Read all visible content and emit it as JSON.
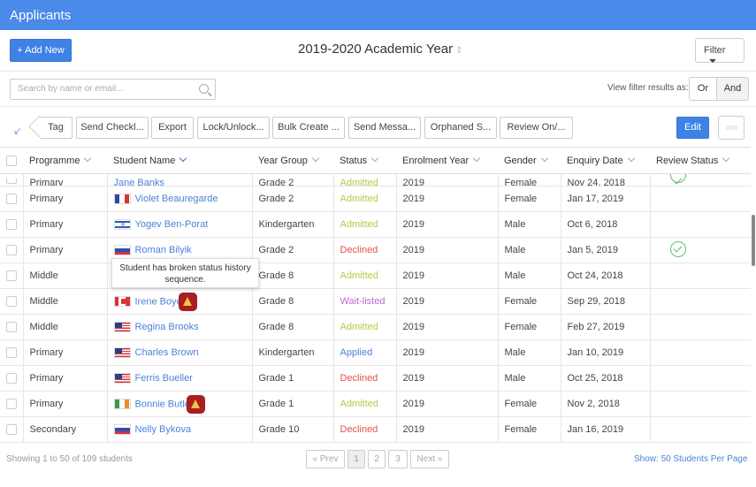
{
  "titlebar": {
    "title": "Applicants"
  },
  "topbar": {
    "add_new": "+ Add New",
    "academic_year": "2019-2020 Academic Year",
    "filter": "Filter"
  },
  "search": {
    "placeholder": "Search by name or email...",
    "view_filter_label": "View filter results as:",
    "or": "Or",
    "and": "And"
  },
  "toolbar": {
    "tag": "Tag",
    "send_checklist": "Send Checkl...",
    "export": "Export",
    "lock_unlock": "Lock/Unlock...",
    "bulk_create": "Bulk Create ...",
    "send_message": "Send Messa...",
    "orphaned": "Orphaned S...",
    "review_on": "Review On/...",
    "edit": "Edit"
  },
  "table": {
    "columns": [
      "Programme",
      "Student Name",
      "Year Group",
      "Status",
      "Enrolment Year",
      "Gender",
      "Enquiry Date",
      "Review Status"
    ],
    "partial_row": {
      "programme": "Primary",
      "name": "Jane Banks",
      "year_group": "Grade 2",
      "status": "Admitted",
      "enrolment": "2019",
      "gender": "Female",
      "date": "Nov 24, 2018"
    },
    "rows": [
      {
        "programme": "Primary",
        "name": "Violet Beauregarde",
        "flag": "fr",
        "year_group": "Grade 2",
        "status": "Admitted",
        "status_class": "admitted",
        "enrolment": "2019",
        "gender": "Female",
        "date": "Jan 17, 2019",
        "review": false,
        "warn": false
      },
      {
        "programme": "Primary",
        "name": "Yogev Ben-Porat",
        "flag": "il",
        "year_group": "Kindergarten",
        "status": "Admitted",
        "status_class": "admitted",
        "enrolment": "2019",
        "gender": "Male",
        "date": "Oct 6, 2018",
        "review": false,
        "warn": false
      },
      {
        "programme": "Primary",
        "name": "Roman Bilyik",
        "flag": "ru",
        "year_group": "Grade 2",
        "status": "Declined",
        "status_class": "declined",
        "enrolment": "2019",
        "gender": "Male",
        "date": "Jan 5, 2019",
        "review": true,
        "warn": false
      },
      {
        "programme": "Middle",
        "name": "",
        "flag": "",
        "year_group": "Grade 8",
        "status": "Admitted",
        "status_class": "admitted",
        "enrolment": "2019",
        "gender": "Male",
        "date": "Oct 24, 2018",
        "review": false,
        "warn": false
      },
      {
        "programme": "Middle",
        "name": "Irene Boye",
        "flag": "ca",
        "year_group": "Grade 8",
        "status": "Wait-listed",
        "status_class": "wait",
        "enrolment": "2019",
        "gender": "Female",
        "date": "Sep 29, 2018",
        "review": false,
        "warn": true
      },
      {
        "programme": "Middle",
        "name": "Regina Brooks",
        "flag": "us",
        "year_group": "Grade 8",
        "status": "Admitted",
        "status_class": "admitted",
        "enrolment": "2019",
        "gender": "Female",
        "date": "Feb 27, 2019",
        "review": false,
        "warn": false
      },
      {
        "programme": "Primary",
        "name": "Charles Brown",
        "flag": "us",
        "year_group": "Kindergarten",
        "status": "Applied",
        "status_class": "applied",
        "enrolment": "2019",
        "gender": "Male",
        "date": "Jan 10, 2019",
        "review": false,
        "warn": false
      },
      {
        "programme": "Primary",
        "name": "Ferris Bueller",
        "flag": "us",
        "year_group": "Grade 1",
        "status": "Declined",
        "status_class": "declined",
        "enrolment": "2019",
        "gender": "Male",
        "date": "Oct 25, 2018",
        "review": false,
        "warn": false
      },
      {
        "programme": "Primary",
        "name": "Bonnie Butle",
        "flag": "ie",
        "year_group": "Grade 1",
        "status": "Admitted",
        "status_class": "admitted",
        "enrolment": "2019",
        "gender": "Female",
        "date": "Nov 2, 2018",
        "review": false,
        "warn": true
      },
      {
        "programme": "Secondary",
        "name": "Nelly Bykova",
        "flag": "ru",
        "year_group": "Grade 10",
        "status": "Declined",
        "status_class": "declined",
        "enrolment": "2019",
        "gender": "Female",
        "date": "Jan 16, 2019",
        "review": false,
        "warn": false
      }
    ]
  },
  "tooltip": {
    "text": "Student has broken status history sequence."
  },
  "footer": {
    "showing": "Showing 1 to 50 of 109 students",
    "prev": "« Prev",
    "pages": [
      "1",
      "2",
      "3"
    ],
    "next": "Next »",
    "show_label": "Show:",
    "per_page_value": "50 Students",
    "per_page_suffix": "Per Page"
  },
  "colors": {
    "accent": "#3e82e6",
    "admitted": "#b8c94a",
    "declined": "#e0534b",
    "waitlisted": "#c06ad6",
    "applied": "#4a82d8"
  }
}
